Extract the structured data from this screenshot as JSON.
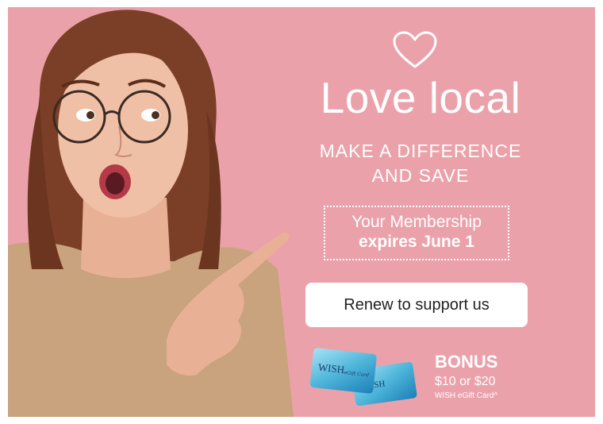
{
  "banner": {
    "title": "Love local",
    "subtitle_line1": "MAKE A DIFFERENCE",
    "subtitle_line2": "AND SAVE",
    "membership_line1": "Your Membership",
    "membership_line2": "expires June 1",
    "renew_button": "Renew to support us",
    "bonus_title": "BONUS",
    "bonus_amount": "$10 or $20",
    "bonus_card": "WISH eGift Card^",
    "card_logo": "WISH",
    "card_script": "eGift Card",
    "background_color": "#eba1aa",
    "heart_icon": "heart-outline-icon"
  }
}
